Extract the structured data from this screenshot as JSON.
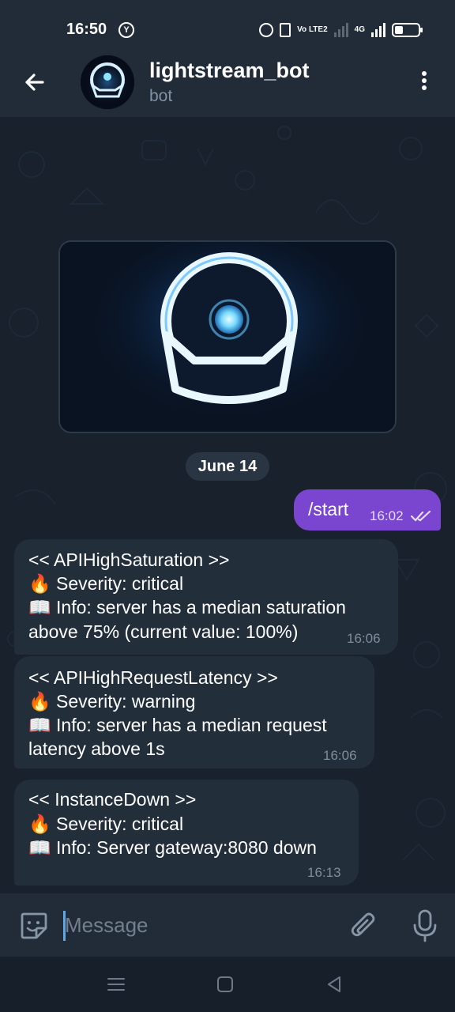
{
  "status_bar": {
    "time": "16:50",
    "network": "4G",
    "volte": "Vo LTE2",
    "battery_level": 0.35
  },
  "header": {
    "title": "lightstream_bot",
    "subtitle": "bot"
  },
  "chat": {
    "date_chip": "June 14",
    "outgoing": {
      "text": "/start",
      "time": "16:02"
    },
    "messages": [
      {
        "lines": [
          "<< APIHighSaturation >>",
          "🔥 Severity: critical",
          "📖 Info: server has a median saturation",
          "above 75% (current value: 100%)"
        ],
        "time": "16:06"
      },
      {
        "lines": [
          "<< APIHighRequestLatency >>",
          "🔥 Severity: warning",
          "📖 Info: server has a median request",
          "latency above 1s"
        ],
        "time": "16:06"
      },
      {
        "lines": [
          "<< InstanceDown >>",
          "🔥 Severity: critical",
          "📖 Info: Server gateway:8080 down"
        ],
        "time": "16:13"
      }
    ]
  },
  "input": {
    "placeholder": "Message"
  },
  "colors": {
    "accent": "#7a45cf",
    "bubble": "#232e3b",
    "header": "#222c38"
  }
}
